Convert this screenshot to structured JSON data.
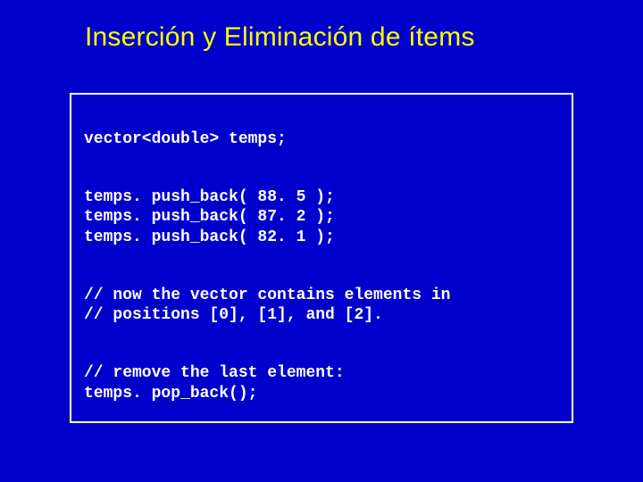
{
  "title": "Inserción y Eliminación de ítems",
  "code": {
    "decl": "vector<double> temps;",
    "push1": "temps. push_back( 88. 5 );",
    "push2": "temps. push_back( 87. 2 );",
    "push3": "temps. push_back( 82. 1 );",
    "comment1": "// now the vector contains elements in",
    "comment2": "// positions [0], [1], and [2].",
    "comment3": "// remove the last element:",
    "pop": "temps. pop_back();"
  }
}
